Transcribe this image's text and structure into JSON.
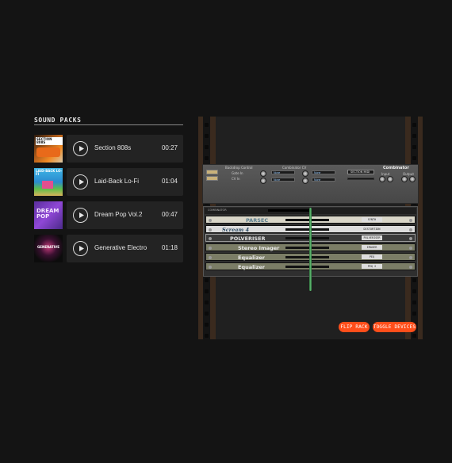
{
  "sound_packs": {
    "title": "SOUND PACKS",
    "items": [
      {
        "name": "Section 808s",
        "duration": "00:27",
        "art": "SECTION 808S"
      },
      {
        "name": "Laid-Back Lo-Fi",
        "duration": "01:04",
        "art": "LAID-BACK LO-FI"
      },
      {
        "name": "Dream Pop Vol.2",
        "duration": "00:47",
        "art": "DREAM POP"
      },
      {
        "name": "Generative Electro",
        "duration": "01:18",
        "art": "GENERATIVE"
      }
    ]
  },
  "rack": {
    "combinator_title": "Combinator",
    "combinator_sub": "COMBINATOR",
    "labels": {
      "run_pattern": "Run",
      "bypass": "Bypass",
      "section_midi": "SECTION MIDI",
      "input": "Input",
      "output": "Output",
      "select_none": "None",
      "backdrop": "Backdrop Control",
      "combinator_cv": "Combinator CV",
      "gate_in": "Gate In",
      "cv_in": "CV In"
    },
    "devices": [
      {
        "name": "PARSEC",
        "tag": "SYNTH",
        "bg": "#d9d6c8",
        "fg": "#5a7c8c"
      },
      {
        "name": "Scream 4",
        "tag": "DISTORTION",
        "bg": "#dcdcdc",
        "fg": "#2c4a63"
      },
      {
        "name": "POLVERISER",
        "tag": "PULVERISER",
        "bg": "#3a3a3a",
        "fg": "#e6e6e6"
      },
      {
        "name": "Stereo Imager",
        "tag": "IMAGER",
        "bg": "#7b7d66",
        "fg": "#eaeaea"
      },
      {
        "name": "Equalizer",
        "tag": "PEQ",
        "bg": "#7b7d66",
        "fg": "#eaeaea"
      },
      {
        "name": "Equalizer",
        "tag": "PEQ 2",
        "bg": "#7b7d66",
        "fg": "#eaeaea"
      }
    ]
  },
  "buttons": {
    "flip_rack": "FLIP RACK",
    "toggle_devices": "TOGGLE DEVICES"
  },
  "colors": {
    "accent": "#ff4e1a",
    "background": "#141414",
    "row_bg": "#232323"
  }
}
